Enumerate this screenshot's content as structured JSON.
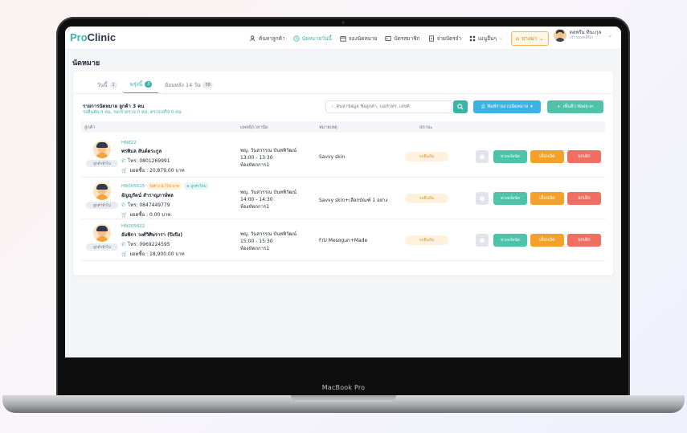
{
  "device": {
    "label": "MacBook Pro"
  },
  "app": {
    "logo_pro": "Pro",
    "logo_clinic": "Clinic"
  },
  "nav": {
    "items": [
      {
        "label": "ค้นหาลูกค้า",
        "icon": "user-search-icon",
        "active": false
      },
      {
        "label": "นัดหมายวันนี้",
        "icon": "clock-icon",
        "active": true
      },
      {
        "label": "จองนัดหมาย",
        "icon": "calendar-add-icon",
        "active": false
      },
      {
        "label": "บัตรสมาชิก",
        "icon": "id-card-icon",
        "active": false
      },
      {
        "label": "จ่ายบัตรจำ",
        "icon": "document-icon",
        "active": false
      },
      {
        "label": "เมนูอื่นๆ",
        "icon": "grid-icon",
        "active": false
      }
    ],
    "branch_label": "บางนา"
  },
  "user": {
    "name": "ดลพรีม ทีนะกุล",
    "role": "เจ้าของคลินิก"
  },
  "page": {
    "title": "นัดหมาย"
  },
  "tabs": [
    {
      "label": "วันนี้",
      "count": "1",
      "active": false
    },
    {
      "label": "พรุ่งนี้",
      "count": "3",
      "active": true
    },
    {
      "label": "ย้อนหลัง 14 วัน",
      "count": "58",
      "active": false
    }
  ],
  "summary": {
    "title": "รายการนัดหมาย ลูกค้า 3 คน",
    "subtitle": "รอยืนยัน 3 คน, รอเข้าตรวจ 0 คน, ตรวจเสร็จ 0 คน"
  },
  "search": {
    "placeholder": "ค้นหาข้อมูล ชื่อลูกค้า, เบอร์โทร, เลขที่"
  },
  "buttons": {
    "print": "พิมพ์รายงานนัดหมาย",
    "walkin": "เพิ่มคิว Walk-in"
  },
  "table": {
    "headers": {
      "customer": "ลูกค้า",
      "doctor": "แพทย์/เวลานัด",
      "reason": "หมายเหตุ",
      "status": "สถานะ"
    },
    "rows": [
      {
        "hn": "HN822",
        "member": "ลูกค้าทั่วไป",
        "name": "พรพิมล สันต์ตระกูล",
        "phone": "โทร: 0801269991",
        "balance": "ยอดซื้อ : 20,879.00 บาท",
        "doctor": "พญ. วันสวรรณ บันทพิวัฒน์",
        "time": "13:00 - 13:30",
        "room": "ห้องหัตถการ1",
        "reason": "Savvy skin",
        "status": "รอยืนยัน",
        "tag_spent": "",
        "tag_star": ""
      },
      {
        "hn": "HN005615",
        "member": "ลูกค้าทั่วไป",
        "name": "อัญญรัตน์ สำราญภาษ์พล",
        "phone": "โทร: 0847449779",
        "balance": "ยอดซื้อ : 0.00 บาท",
        "doctor": "พญ. วันสวรรณ บันทพิวัฒน์",
        "time": "14:00 - 14:30",
        "room": "ห้องหัตถการ1",
        "reason": "Savvy skin+เลือกบัณฑ์ 1 อย่าง",
        "status": "รอยืนยัน",
        "tag_spent": "ยังค้าง 8,750 บาท",
        "tag_star": "ลูกค้าใหม่"
      },
      {
        "hn": "HN005622",
        "member": "ลูกค้าทั่วไป",
        "name": "อัมพิกา วงศ์วิศิษรารา (ปิงปิง)",
        "phone": "โทร: 0969224595",
        "balance": "ยอดซื้อ : 18,900.00 บาท",
        "doctor": "พญ. วันสวรรณ บันทพิวัฒน์",
        "time": "15:00 - 15:30",
        "room": "ห้องหัตถการ1",
        "reason": "F/U Mesogun+Made",
        "status": "รอยืนยัน",
        "tag_spent": "",
        "tag_star": ""
      }
    ],
    "actions": {
      "remind": "ทวงแจ้งนัด",
      "postpone": "เลื่อนนัด",
      "cancel": "ยกเลิก"
    }
  },
  "colors": {
    "brand": "#3bb4a8",
    "print": "#3db2e6",
    "walkin": "#4fc3a9",
    "postpone": "#f4a12b",
    "cancel": "#ef6f63",
    "status_pending": "#e8961f"
  }
}
